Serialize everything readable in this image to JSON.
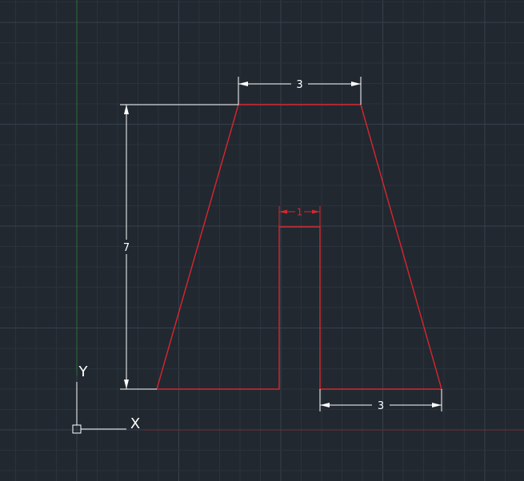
{
  "app": {
    "view": "cad-model-space"
  },
  "colors": {
    "background": "#212830",
    "grid_minor": "#2a323b",
    "grid_major": "#36404b",
    "y_axis_line": "#2f6b3a",
    "x_axis_line": "#7a2d33",
    "geometry": "#d9262e",
    "dimension_white": "#ffffff",
    "dimension_red": "#d9262e"
  },
  "dimensions": {
    "top_width": "3",
    "height": "7",
    "slot_width": "1",
    "bottom_right_width": "3"
  },
  "ucs": {
    "x_label": "X",
    "y_label": "Y"
  }
}
